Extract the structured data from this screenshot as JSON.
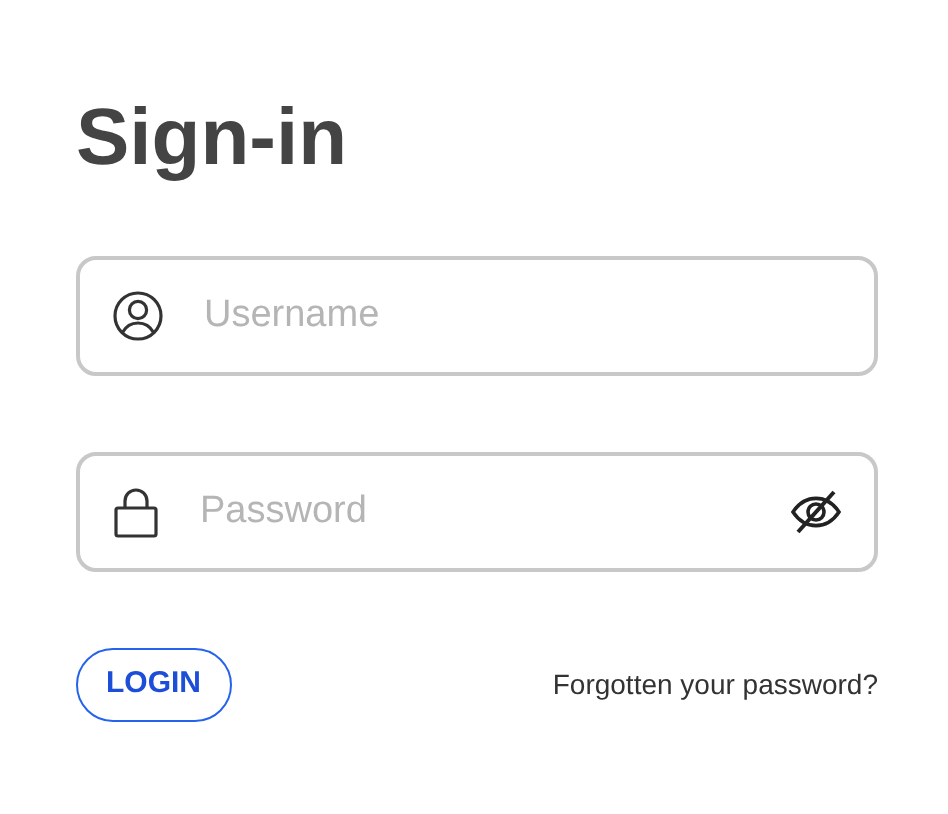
{
  "title": "Sign-in",
  "fields": [
    {
      "kind": "username",
      "placeholder": "Username"
    },
    {
      "kind": "password",
      "placeholder": "Password",
      "revealed": false
    }
  ],
  "login_button": "LOGIN",
  "forgot_link": "Forgotten your password?"
}
